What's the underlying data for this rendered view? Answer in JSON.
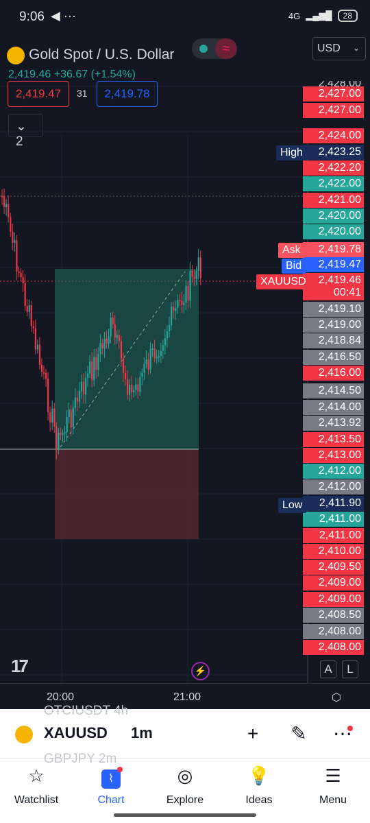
{
  "status": {
    "time": "9:06",
    "icons": "◀ ···",
    "network": "4G",
    "battery": "28"
  },
  "header": {
    "title": "Gold Spot / U.S. Dollar",
    "last": "2,419.46",
    "change": "+36.67",
    "change_pct": "(+1.54%)",
    "currency": "USD",
    "sell_price": "2,419.47",
    "spread": "31",
    "buy_price": "2,419.78",
    "indicators_count": "2"
  },
  "price_axis": {
    "top_partial": "2,428.00",
    "labels": [
      {
        "v": "2,427.00",
        "c": "#f23645"
      },
      {
        "v": "2,427.00",
        "c": "#f23645"
      },
      {
        "v": "2,424.00",
        "c": "#f23645"
      },
      {
        "v": "2,423.25",
        "c": "#1a2d5a"
      },
      {
        "v": "2,422.20",
        "c": "#f23645"
      },
      {
        "v": "2,422.00",
        "c": "#26a69a"
      },
      {
        "v": "2,421.00",
        "c": "#f23645"
      },
      {
        "v": "2,420.00",
        "c": "#26a69a"
      },
      {
        "v": "2,420.00",
        "c": "#26a69a"
      },
      {
        "v": "2,419.78",
        "c": "#f7525f"
      },
      {
        "v": "2,419.47",
        "c": "#2962ff"
      },
      {
        "v": "2,419.46",
        "c": "#f23645"
      },
      {
        "v": "00:41",
        "c": "#f23645"
      },
      {
        "v": "2,419.10",
        "c": "#787b86"
      },
      {
        "v": "2,419.00",
        "c": "#787b86"
      },
      {
        "v": "2,418.84",
        "c": "#787b86"
      },
      {
        "v": "2,416.50",
        "c": "#787b86"
      },
      {
        "v": "2,416.00",
        "c": "#f23645"
      },
      {
        "v": "2,414.50",
        "c": "#787b86"
      },
      {
        "v": "2,414.00",
        "c": "#787b86"
      },
      {
        "v": "2,413.92",
        "c": "#787b86"
      },
      {
        "v": "2,413.50",
        "c": "#f23645"
      },
      {
        "v": "2,413.00",
        "c": "#f23645"
      },
      {
        "v": "2,412.00",
        "c": "#26a69a"
      },
      {
        "v": "2,412.00",
        "c": "#787b86"
      },
      {
        "v": "2,411.90",
        "c": "#1a2d5a"
      },
      {
        "v": "2,411.00",
        "c": "#26a69a"
      },
      {
        "v": "2,411.00",
        "c": "#f23645"
      },
      {
        "v": "2,410.00",
        "c": "#f23645"
      },
      {
        "v": "2,409.50",
        "c": "#f23645"
      },
      {
        "v": "2,409.00",
        "c": "#f23645"
      },
      {
        "v": "2,409.00",
        "c": "#f23645"
      },
      {
        "v": "2,408.50",
        "c": "#787b86"
      },
      {
        "v": "2,408.00",
        "c": "#787b86"
      },
      {
        "v": "2,408.00",
        "c": "#f23645"
      }
    ]
  },
  "tags": {
    "high": "High",
    "ask": "Ask",
    "bid": "Bid",
    "symbol": "XAUUSD",
    "low": "Low"
  },
  "time_axis": {
    "t1": "20:00",
    "t2": "21:00"
  },
  "chart_buttons": {
    "a": "A",
    "l": "L"
  },
  "toolbar": {
    "symbol": "XAUUSD",
    "timeframe": "1m",
    "ghost_above": "OTCIUSDT 4h",
    "ghost_below": "GBPJPY 2m"
  },
  "nav": [
    {
      "label": "Watchlist",
      "icon": "star-icon"
    },
    {
      "label": "Chart",
      "icon": "chart-icon"
    },
    {
      "label": "Explore",
      "icon": "compass-icon"
    },
    {
      "label": "Ideas",
      "icon": "lightbulb-icon"
    },
    {
      "label": "Menu",
      "icon": "menu-icon"
    }
  ],
  "colors": {
    "up": "#26a69a",
    "down": "#f23645",
    "bg": "#131722",
    "accent": "#2962ff"
  }
}
